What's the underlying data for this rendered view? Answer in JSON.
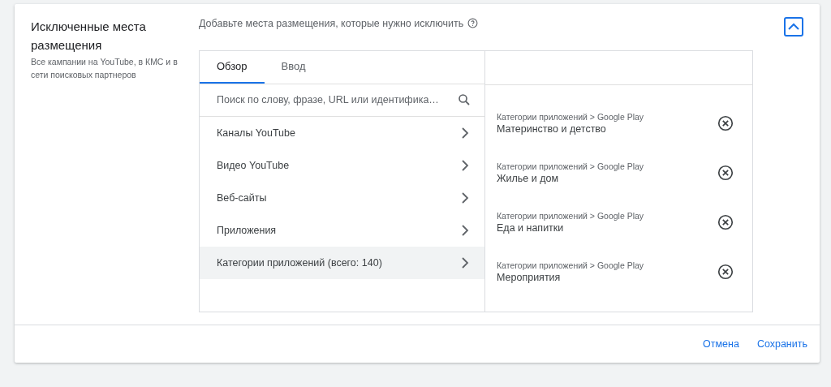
{
  "section": {
    "title": "Исключенные места размещения",
    "subtitle": "Все кампании на YouTube, в КМС и в сети поисковых партнеров"
  },
  "prompt": "Добавьте места размещения, которые нужно исключить",
  "tabs": [
    {
      "label": "Обзор",
      "selected": true
    },
    {
      "label": "Ввод",
      "selected": false
    }
  ],
  "search": {
    "placeholder": "Поиск по слову, фразе, URL или идентифика…"
  },
  "categories": [
    {
      "label": "Каналы YouTube",
      "selected": false
    },
    {
      "label": "Видео YouTube",
      "selected": false
    },
    {
      "label": "Веб-сайты",
      "selected": false
    },
    {
      "label": "Приложения",
      "selected": false
    },
    {
      "label": "Категории приложений (всего: 140)",
      "selected": true
    }
  ],
  "excluded": [
    {
      "path": "Категории приложений > Google Play",
      "name": "Материнство и детство"
    },
    {
      "path": "Категории приложений > Google Play",
      "name": "Жилье и дом"
    },
    {
      "path": "Категории приложений > Google Play",
      "name": "Еда и напитки"
    },
    {
      "path": "Категории приложений > Google Play",
      "name": "Мероприятия"
    }
  ],
  "buttons": [
    {
      "label": "Отмена"
    },
    {
      "label": "Сохранить"
    }
  ]
}
